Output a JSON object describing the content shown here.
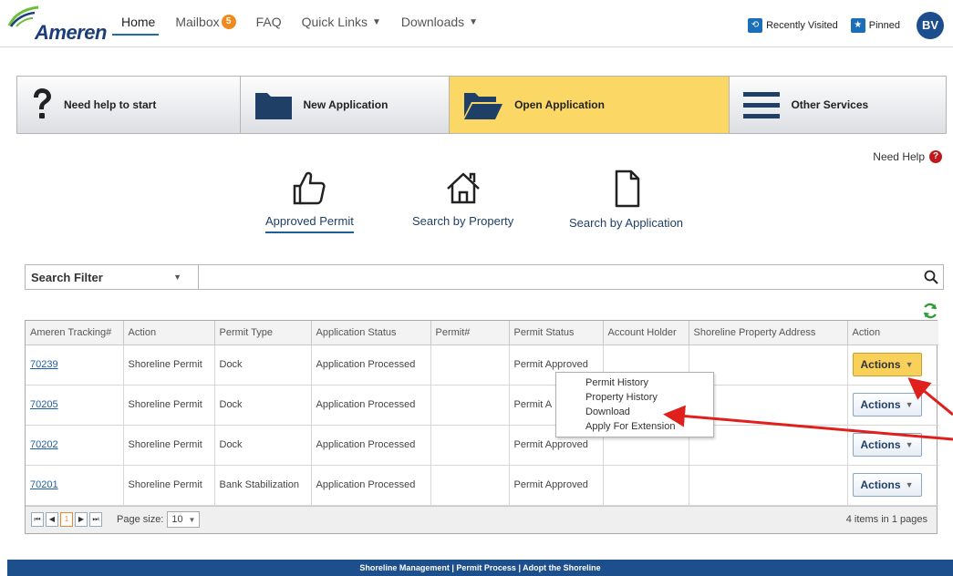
{
  "brand": {
    "logo_text": "Ameren"
  },
  "nav": {
    "home": "Home",
    "mailbox": "Mailbox",
    "mailbox_count": "5",
    "faq": "FAQ",
    "quick_links": "Quick Links",
    "downloads": "Downloads"
  },
  "top_right": {
    "recently_visited": "Recently Visited",
    "pinned": "Pinned",
    "avatar_initials": "BV"
  },
  "tiles": [
    {
      "label": "Need help to start"
    },
    {
      "label": "New Application"
    },
    {
      "label": "Open Application"
    },
    {
      "label": "Other Services"
    }
  ],
  "help": {
    "label": "Need Help",
    "icon": "?"
  },
  "search_options": [
    {
      "label": "Approved Permit"
    },
    {
      "label": "Search by Property"
    },
    {
      "label": "Search by Application"
    }
  ],
  "filter": {
    "select_label": "Search Filter",
    "input_value": ""
  },
  "grid": {
    "columns": [
      "Ameren Tracking#",
      "Action",
      "Permit Type",
      "Application Status",
      "Permit#",
      "Permit Status",
      "Account Holder",
      "Shoreline Property Address",
      "Action"
    ],
    "rows": [
      {
        "tracking": "70239",
        "action": "Shoreline Permit",
        "type": "Dock",
        "app_status": "Application Processed",
        "permit_no": "",
        "permit_status": "Permit Approved",
        "holder": "",
        "address": "",
        "button": "Actions"
      },
      {
        "tracking": "70205",
        "action": "Shoreline Permit",
        "type": "Dock",
        "app_status": "Application Processed",
        "permit_no": "",
        "permit_status": "Permit A",
        "holder": "",
        "address": "",
        "button": "Actions"
      },
      {
        "tracking": "70202",
        "action": "Shoreline Permit",
        "type": "Dock",
        "app_status": "Application Processed",
        "permit_no": "",
        "permit_status": "Permit Approved",
        "holder": "",
        "address": "",
        "button": "Actions"
      },
      {
        "tracking": "70201",
        "action": "Shoreline Permit",
        "type": "Bank Stabilization",
        "app_status": "Application Processed",
        "permit_no": "",
        "permit_status": "Permit Approved",
        "holder": "",
        "address": "",
        "button": "Actions"
      }
    ],
    "pager": {
      "current_page": "1",
      "page_size_label": "Page size:",
      "page_size": "10",
      "info": "4 items in 1 pages"
    }
  },
  "context_menu": {
    "items": [
      "Permit History",
      "Property History",
      "Download",
      "Apply For Extension"
    ]
  },
  "footer": {
    "links": [
      "Shoreline Management",
      "Permit Process",
      "Adopt the Shoreline"
    ],
    "separator": " | "
  },
  "colors": {
    "brand_blue": "#1c3f78",
    "active_tile": "#fbd765",
    "annotation_red": "#e0201c",
    "footer_blue": "#1c4f8c"
  }
}
